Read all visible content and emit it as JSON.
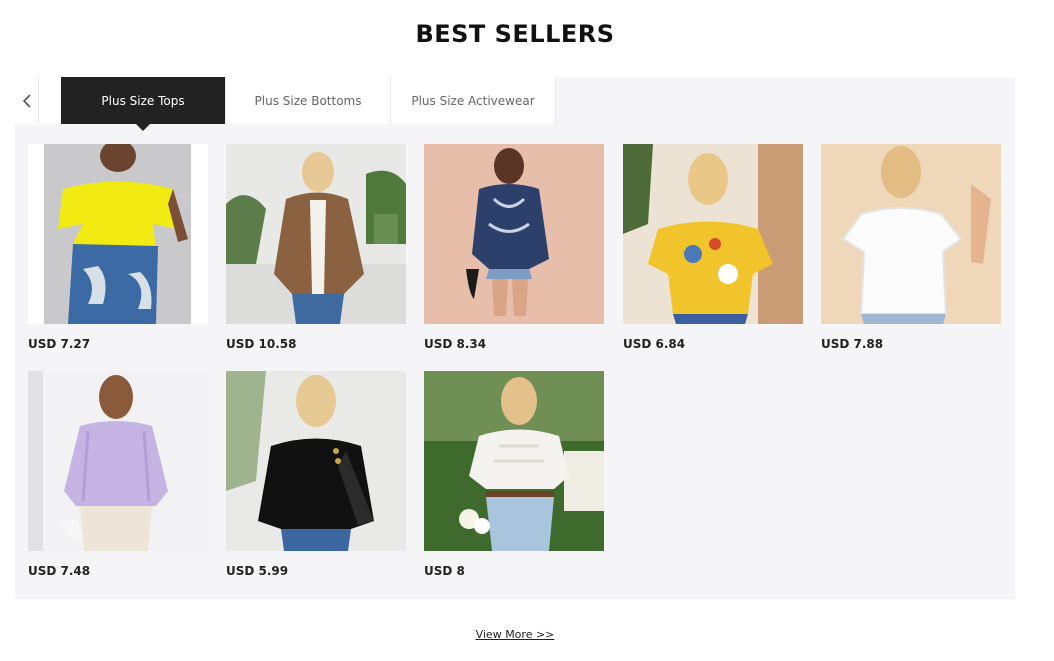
{
  "section": {
    "title": "BEST SELLERS"
  },
  "tabs": {
    "prev_icon": "chevron-left-icon",
    "items": [
      {
        "label": "Plus Size Tops",
        "active": true
      },
      {
        "label": "Plus Size Bottoms",
        "active": false
      },
      {
        "label": "Plus Size Activewear",
        "active": false
      }
    ]
  },
  "products": [
    {
      "price": "USD 7.27",
      "image": "yellow-off-shoulder-top"
    },
    {
      "price": "USD 10.58",
      "image": "brown-houndstooth-jacket"
    },
    {
      "price": "USD 8.34",
      "image": "navy-paisley-shirt"
    },
    {
      "price": "USD 6.84",
      "image": "yellow-floral-square-neck-top"
    },
    {
      "price": "USD 7.88",
      "image": "white-puff-sleeve-blouse"
    },
    {
      "price": "USD 7.48",
      "image": "lilac-ruffle-peplum-top"
    },
    {
      "price": "USD 5.99",
      "image": "black-lace-sleeve-sweater"
    },
    {
      "price": "USD 8",
      "image": "white-lace-puff-sleeve-blouse"
    }
  ],
  "footer": {
    "view_more": "View More >>"
  },
  "colors": {
    "panel_bg": "#f5f5f7",
    "active_tab_bg": "#222222",
    "active_tab_text": "#ffffff",
    "inactive_tab_text": "#666666"
  }
}
